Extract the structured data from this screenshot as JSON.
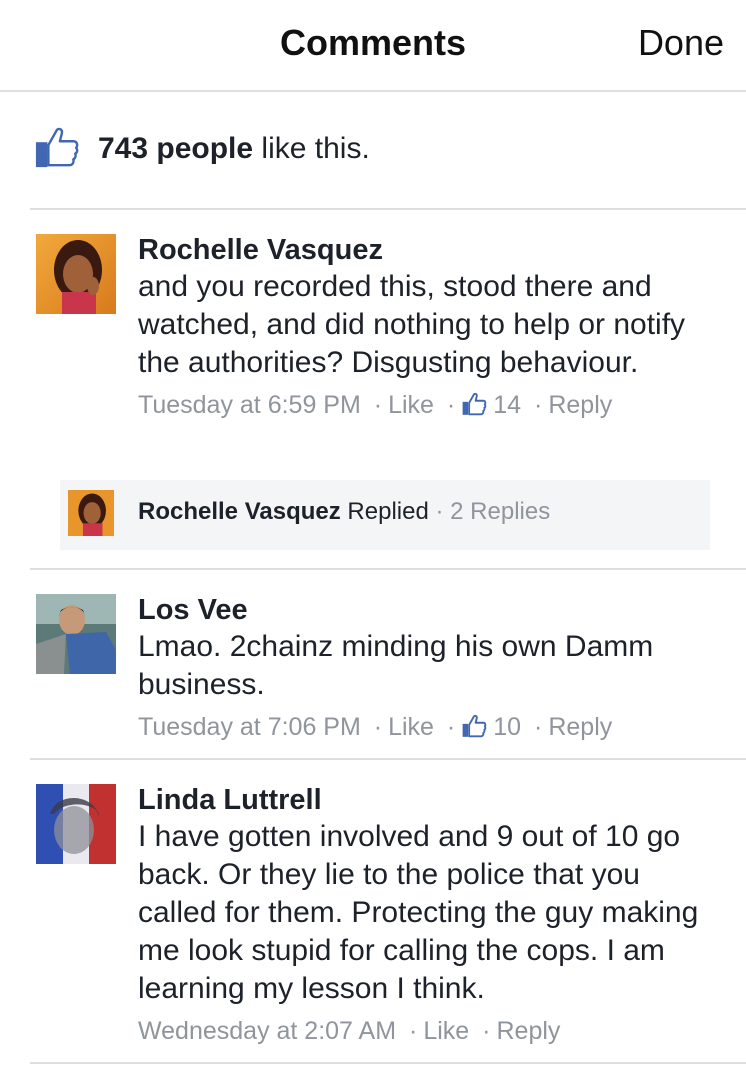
{
  "header": {
    "title": "Comments",
    "done_label": "Done"
  },
  "likes": {
    "count_text": "743 people",
    "suffix": "like this."
  },
  "comments": [
    {
      "author": "Rochelle Vasquez",
      "text": "and you recorded this, stood there and watched, and did nothing to help or notify the authorities? Disgusting behaviour.",
      "time": "Tuesday at 6:59 PM",
      "like_label": "Like",
      "like_count": "14",
      "reply_label": "Reply",
      "replies": {
        "author": "Rochelle Vasquez",
        "action": "Replied",
        "count_label": "2 Replies"
      }
    },
    {
      "author": "Los Vee",
      "text": "Lmao. 2chainz minding his own Damm business.",
      "time": "Tuesday at 7:06 PM",
      "like_label": "Like",
      "like_count": "10",
      "reply_label": "Reply"
    },
    {
      "author": "Linda Luttrell",
      "text": "I have gotten involved and 9 out of 10 go back. Or they lie to the police that you called for them. Protecting the guy making me look stupid for calling the cops. I am learning my lesson I think.",
      "time": "Wednesday at 2:07 AM",
      "like_label": "Like",
      "reply_label": "Reply"
    }
  ],
  "colors": {
    "facebook_blue": "#4267b2",
    "meta_gray": "#90949c",
    "divider": "#dddfe2"
  }
}
